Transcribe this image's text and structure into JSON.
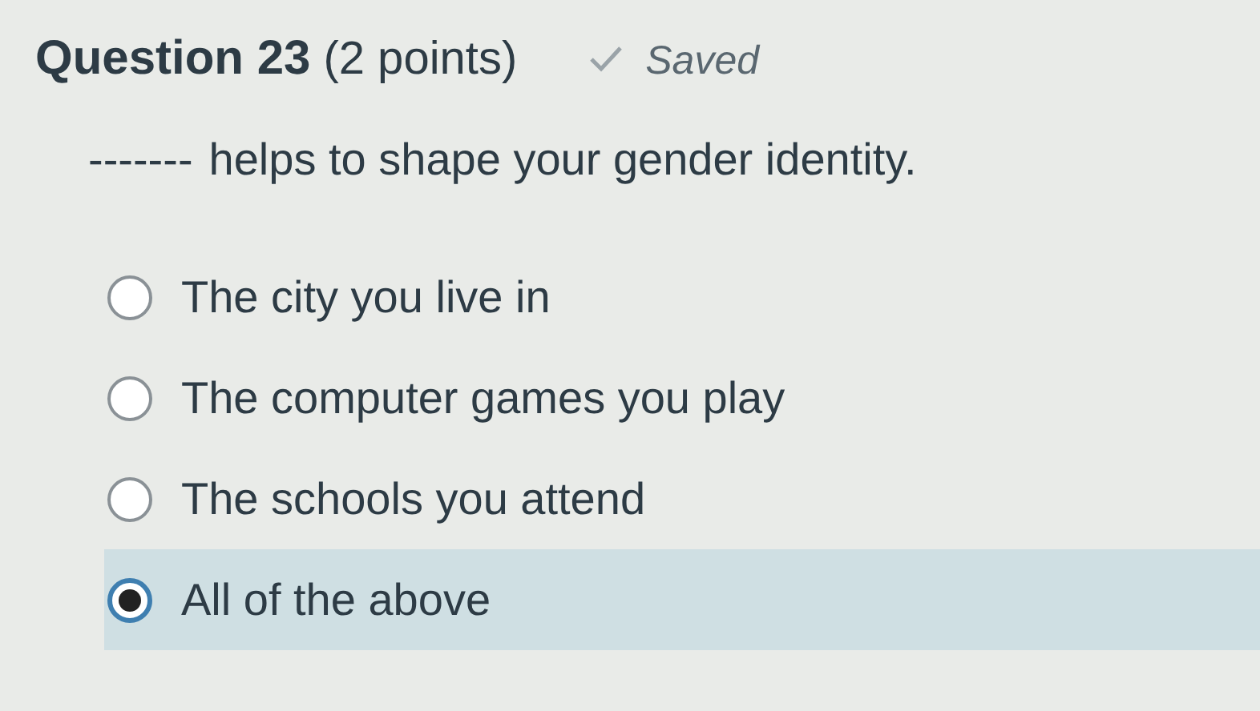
{
  "question": {
    "title": "Question 23",
    "points": "(2 points)",
    "status": "Saved"
  },
  "prompt": {
    "blank": "-------",
    "text": "helps to shape your gender identity."
  },
  "options": [
    {
      "label": "The city you live in",
      "selected": false
    },
    {
      "label": "The computer games you play",
      "selected": false
    },
    {
      "label": "The schools you attend",
      "selected": false
    },
    {
      "label": "All of the above",
      "selected": true
    }
  ]
}
